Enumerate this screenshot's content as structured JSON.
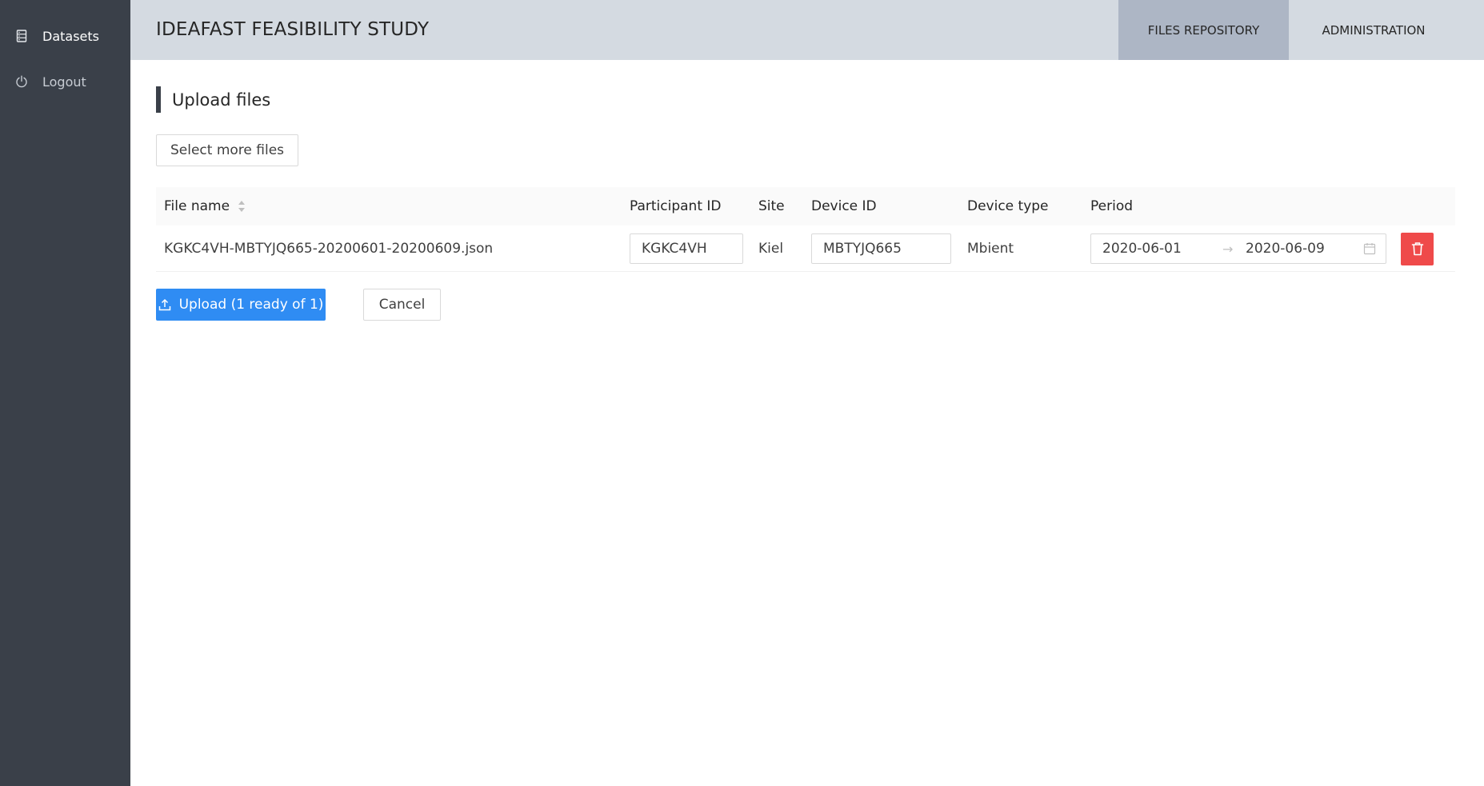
{
  "sidebar": {
    "items": [
      {
        "label": "Datasets",
        "icon": "database-icon"
      },
      {
        "label": "Logout",
        "icon": "power-icon"
      }
    ]
  },
  "header": {
    "title": "IDEAFAST FEASIBILITY STUDY",
    "tabs": [
      {
        "label": "FILES REPOSITORY",
        "active": true
      },
      {
        "label": "ADMINISTRATION",
        "active": false
      }
    ]
  },
  "upload": {
    "title": "Upload files",
    "select_more_label": "Select more files",
    "table": {
      "columns": [
        "File name",
        "Participant ID",
        "Site",
        "Device ID",
        "Device type",
        "Period"
      ],
      "rows": [
        {
          "file_name": "KGKC4VH-MBTYJQ665-20200601-20200609.json",
          "participant_id": "KGKC4VH",
          "site": "Kiel",
          "device_id": "MBTYJQ665",
          "device_type": "Mbient",
          "period_start": "2020-06-01",
          "period_end": "2020-06-09"
        }
      ]
    },
    "upload_label": "Upload (1 ready of 1)",
    "cancel_label": "Cancel"
  },
  "colors": {
    "sidebar_bg": "#3a4049",
    "header_bg": "#d4dae1",
    "active_tab_bg": "#adb6c5",
    "primary": "#2f8cf3",
    "danger": "#ef4a4a"
  }
}
